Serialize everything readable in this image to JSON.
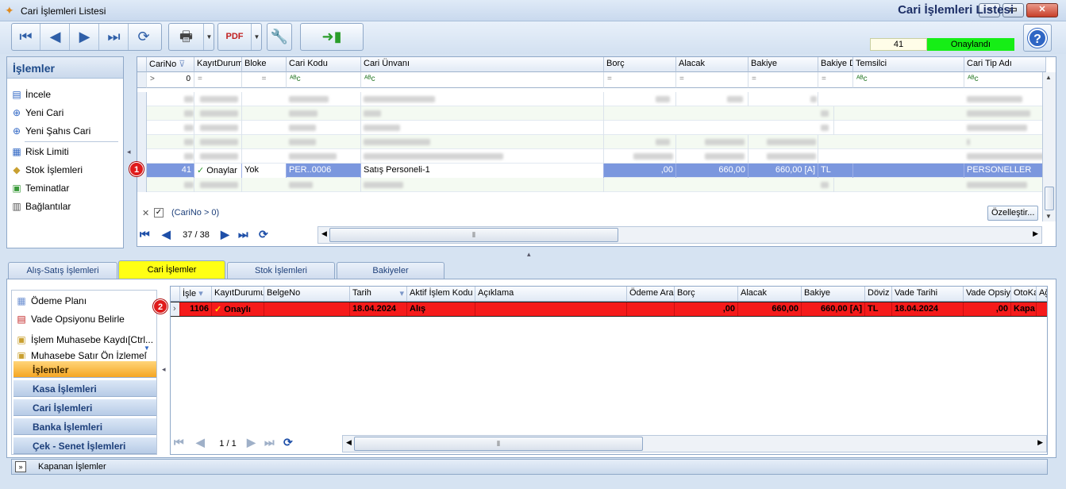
{
  "window": {
    "title": "Cari İşlemleri Listesi"
  },
  "header": {
    "title": "Cari İşlemleri Listesi",
    "count": "41",
    "status": "Onaylandı",
    "status_color": "#16ee16"
  },
  "toolbar": {
    "nav_icons": [
      "first-icon",
      "prev-icon",
      "next-icon",
      "last-icon",
      "refresh-icon"
    ],
    "print_icon": "printer-icon",
    "pdf_icon": "pdf-save-icon",
    "tool_icon": "wrench-icon",
    "exit_icon": "exit-door-icon",
    "help": "?"
  },
  "left_panel": {
    "title": "İşlemler",
    "items": [
      "İncele",
      "Yeni Cari",
      "Yeni Şahıs Cari",
      "Risk Limiti",
      "Stok İşlemleri",
      "Teminatlar",
      "Bağlantılar"
    ]
  },
  "grid": {
    "columns": [
      "CariNo",
      "KayıtDurumu",
      "Bloke",
      "Cari Kodu",
      "Cari Ünvanı",
      "Borç",
      "Alacak",
      "Bakiye",
      "Bakiye D",
      "Temsilci",
      "Cari Tip Adı"
    ],
    "filter_row": {
      "carino": "0",
      "eq": "=",
      "text": "ᴬᴮc"
    },
    "selected_row": {
      "carino": "41",
      "kayit": "Onaylar",
      "bloke": "Yok",
      "kod": "PER..0006",
      "unvan": "Satış Personeli-1",
      "borc": ",00",
      "alacak": "660,00",
      "bakiye": "660,00 [A]",
      "doviz": "TL",
      "temsilci": "",
      "tip": "PERSONELLER"
    },
    "filter_text": "(CariNo > 0)",
    "customize_label": "Özelleştir...",
    "page": "37 / 38"
  },
  "badges": {
    "one": "1",
    "two": "2"
  },
  "tabs": [
    "Alış-Satış İşlemleri",
    "Cari İşlemler",
    "Stok İşlemleri",
    "Bakiyeler"
  ],
  "bottom_left": {
    "items": [
      "Ödeme Planı",
      "Vade Opsiyonu Belirle",
      "İşlem Muhasebe Kaydı[Ctrl...",
      "Muhasebe Satır Ön İzleme["
    ],
    "groups": [
      "İşlemler",
      "Kasa İşlemleri",
      "Cari İşlemleri",
      "Banka İşlemleri",
      "Çek - Senet İşlemleri"
    ]
  },
  "grid2": {
    "columns": [
      "İşle",
      "KayıtDurumu",
      "BelgeNo",
      "Tarih",
      "Aktif İşlem Kodu",
      "Açıklama",
      "Ödeme Ara",
      "Borç",
      "Alacak",
      "Bakiye",
      "Döviz",
      "Vade Tarihi",
      "Vade Opsiy",
      "OtoKa",
      "Ağı"
    ],
    "row": {
      "isle": "1106",
      "kayit": "Onaylı",
      "belge": "",
      "tarih": "18.04.2024",
      "kod": "Alış",
      "aciklama": "",
      "odeme": "",
      "borc": ",00",
      "alacak": "660,00",
      "bakiye": "660,00 [A]",
      "doviz": "TL",
      "vade": "18.04.2024",
      "opsiyon": ",00",
      "otok": "Kapa"
    },
    "page": "1 / 1"
  },
  "footer": {
    "label": "Kapanan İşlemler"
  }
}
